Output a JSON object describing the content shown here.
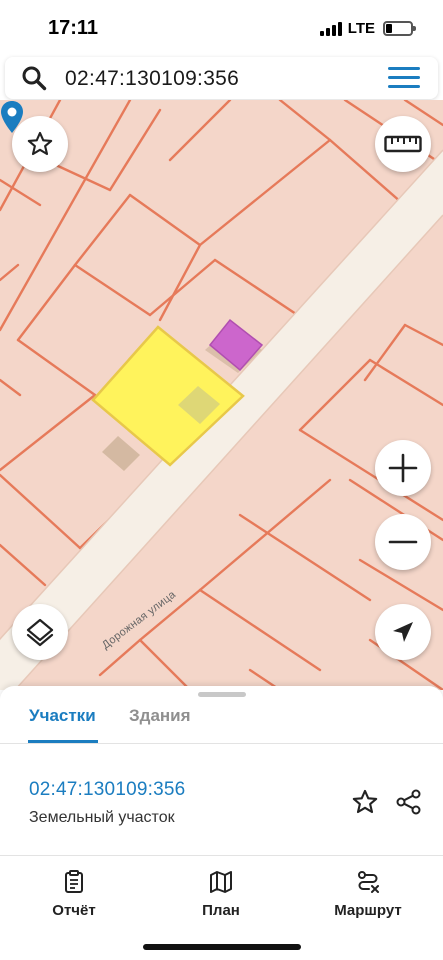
{
  "status_bar": {
    "time": "17:11",
    "network": "LTE"
  },
  "search": {
    "query": "02:47:130109:356"
  },
  "map": {
    "street_label": "Дорожная улица",
    "colors": {
      "background": "#f4d6c9",
      "parcel_border": "#e67a5a",
      "road": "#f5f0e8",
      "selected_parcel": "#fff35c",
      "building": "#d4b9a2",
      "building_highlight": "#cc66cc"
    }
  },
  "map_controls": {
    "favorite": "star-icon",
    "ruler": "ruler-icon",
    "zoom_in": "plus-icon",
    "zoom_out": "minus-icon",
    "layers": "layers-icon",
    "locate": "navigation-arrow-icon"
  },
  "sheet": {
    "tabs": [
      {
        "label": "Участки",
        "active": true
      },
      {
        "label": "Здания",
        "active": false
      }
    ],
    "result": {
      "cadastral_number": "02:47:130109:356",
      "type": "Земельный участок"
    }
  },
  "bottom_nav": [
    {
      "label": "Отчёт",
      "icon": "report-icon"
    },
    {
      "label": "План",
      "icon": "map-icon"
    },
    {
      "label": "Маршрут",
      "icon": "route-icon"
    }
  ],
  "accent_color": "#1b7dc0"
}
